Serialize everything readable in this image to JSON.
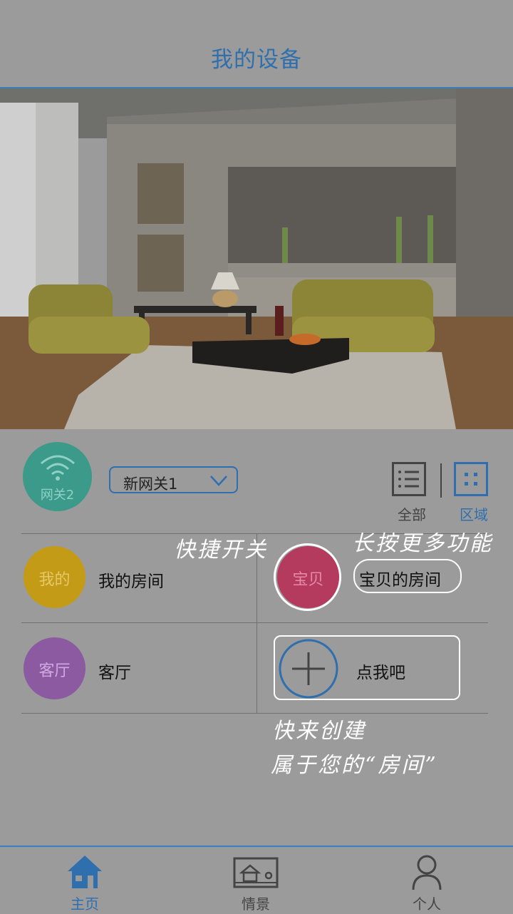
{
  "header": {
    "title": "我的设备"
  },
  "gateway": {
    "circle_label": "网关2",
    "selected": "新网关1"
  },
  "view_toggle": {
    "all_label": "全部",
    "area_label": "区域",
    "active": "区域"
  },
  "rooms": [
    {
      "badge": "我的",
      "name": "我的房间",
      "color": "#c49b17"
    },
    {
      "badge": "宝贝",
      "name": "宝贝的房间",
      "color": "#b43a5e"
    },
    {
      "badge": "客厅",
      "name": "客厅",
      "color": "#8b5aa0"
    }
  ],
  "add_room": {
    "label": "点我吧"
  },
  "hints": {
    "quick_switch": "快捷开关",
    "long_press": "长按更多功能",
    "create_line1": "快来创建",
    "create_line2": "属于您的“房间”"
  },
  "tabs": [
    {
      "label": "主页",
      "icon": "home-icon",
      "active": true
    },
    {
      "label": "情景",
      "icon": "scene-icon",
      "active": false
    },
    {
      "label": "个人",
      "icon": "person-icon",
      "active": false
    }
  ],
  "colors": {
    "accent": "#2f6fae",
    "overlay": "#9b9b9b",
    "gateway": "#3b9a8a"
  }
}
